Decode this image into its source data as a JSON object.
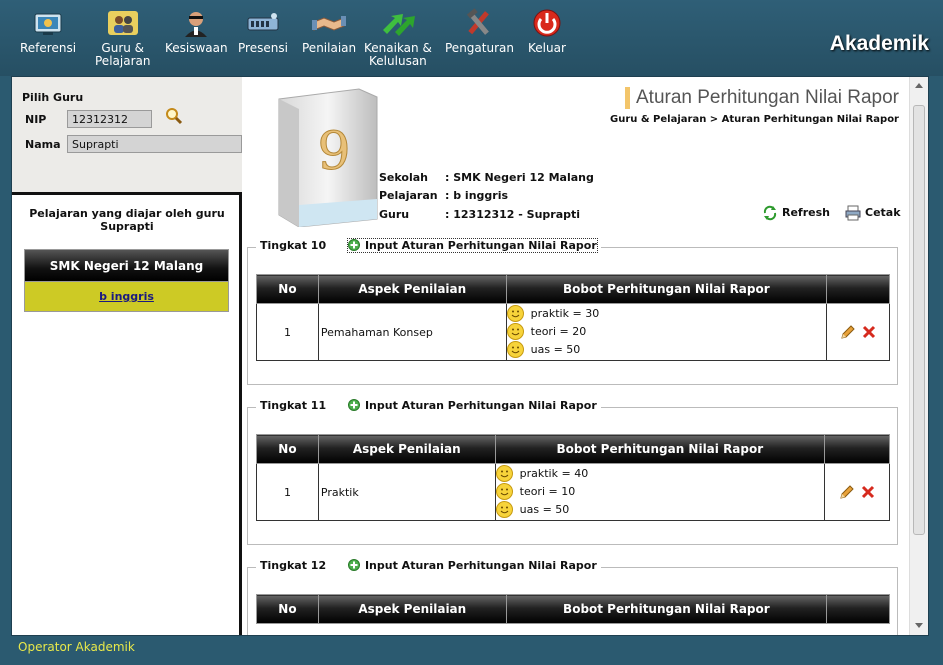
{
  "nav": {
    "items": [
      {
        "label": "Referensi",
        "icon": "reference-monitor-icon"
      },
      {
        "label": "Guru &",
        "label2": "Pelajaran",
        "icon": "teachers-icon"
      },
      {
        "label": "Kesiswaan",
        "icon": "student-icon"
      },
      {
        "label": "Presensi",
        "icon": "attendance-icon"
      },
      {
        "label": "Penilaian",
        "icon": "handshake-icon"
      },
      {
        "label": "Kenaikan &",
        "label2": "Kelulusan",
        "icon": "promotion-arrows-icon"
      },
      {
        "label": "Pengaturan",
        "icon": "tools-icon"
      },
      {
        "label": "Keluar",
        "icon": "power-icon"
      }
    ],
    "app_title": "Akademik"
  },
  "left": {
    "pilih_title": "Pilih Guru",
    "nip_label": "NIP",
    "nip_value": "12312312",
    "nama_label": "Nama",
    "nama_value": "Suprapti",
    "pelajaran_title": "Pelajaran yang diajar oleh guru Suprapti",
    "school": "SMK Negeri 12 Malang",
    "subject": "b inggris"
  },
  "main": {
    "page_title": "Aturan Perhitungan Nilai Rapor",
    "breadcrumb": "Guru & Pelajaran >  Aturan Perhitungan Nilai Rapor",
    "folder_number": "9",
    "sekolah_label": "Sekolah",
    "sekolah_value": ": SMK Negeri 12 Malang",
    "pelajaran_label": "Pelajaran",
    "pelajaran_value": ": b inggris",
    "guru_label": "Guru",
    "guru_value": ": 12312312 - Suprapti",
    "refresh": "Refresh",
    "cetak": "Cetak",
    "input_link": "Input Aturan Perhitungan Nilai Rapor",
    "headers": {
      "no": "No",
      "aspek": "Aspek Penilaian",
      "bobot": "Bobot Perhitungan Nilai Rapor"
    },
    "tingkat": [
      {
        "title": "Tingkat 10",
        "rows": [
          {
            "no": "1",
            "aspek": "Pemahaman Konsep",
            "bobot": [
              "praktik = 30",
              "teori = 20",
              "uas = 50"
            ]
          }
        ]
      },
      {
        "title": "Tingkat 11",
        "rows": [
          {
            "no": "1",
            "aspek": "Praktik",
            "bobot": [
              "praktik = 40",
              "teori = 10",
              "uas = 50"
            ]
          }
        ]
      },
      {
        "title": "Tingkat 12",
        "rows": []
      }
    ]
  },
  "footer": {
    "text": "Operator Akademik"
  },
  "colors": {
    "nav_bg": "#2b5a70",
    "accent_yellow": "#cdca25",
    "title_bar": "#f3c56a"
  }
}
